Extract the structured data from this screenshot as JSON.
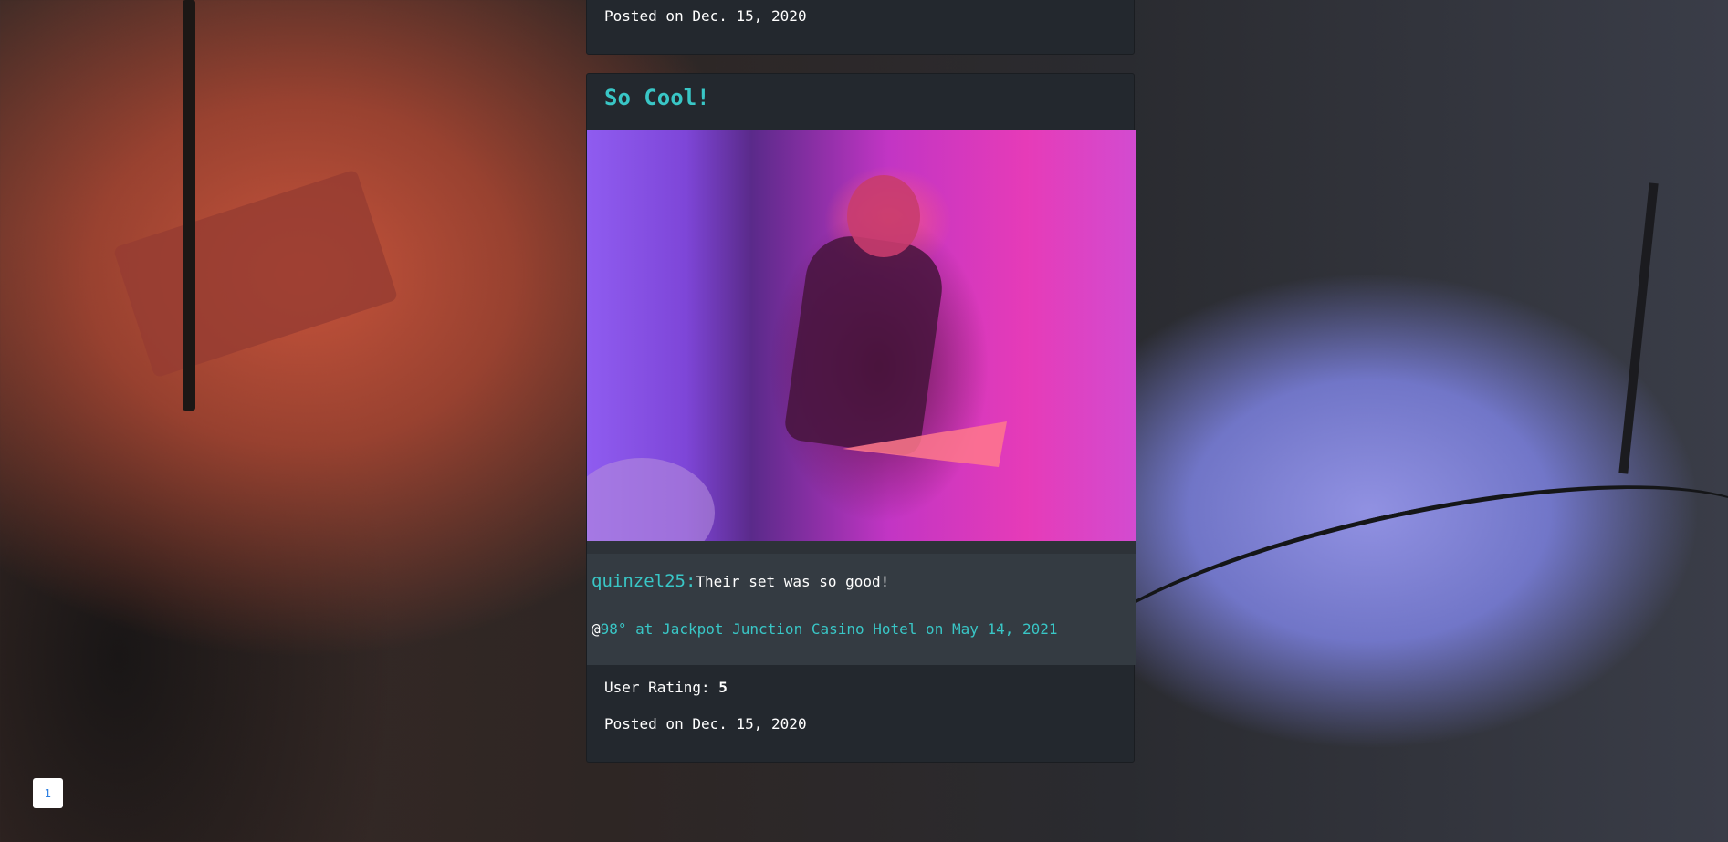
{
  "posts": [
    {
      "posted_label": "Posted on",
      "posted_date": "Dec. 15, 2020"
    },
    {
      "title": "So Cool!",
      "comment": {
        "user": "quinzel25:",
        "text": "Their set was so good!"
      },
      "event": {
        "at": "@",
        "link_text": "98° at Jackpot Junction Casino Hotel on May 14, 2021"
      },
      "rating_label": "User Rating:",
      "rating_value": "5",
      "posted_label": "Posted on",
      "posted_date": "Dec. 15, 2020"
    }
  ],
  "pagination": {
    "current_page": "1"
  },
  "colors": {
    "accent": "#39c6c6",
    "card_bg": "#23282e",
    "comment_bg": "#343b42",
    "pager_text": "#2a7de1"
  }
}
